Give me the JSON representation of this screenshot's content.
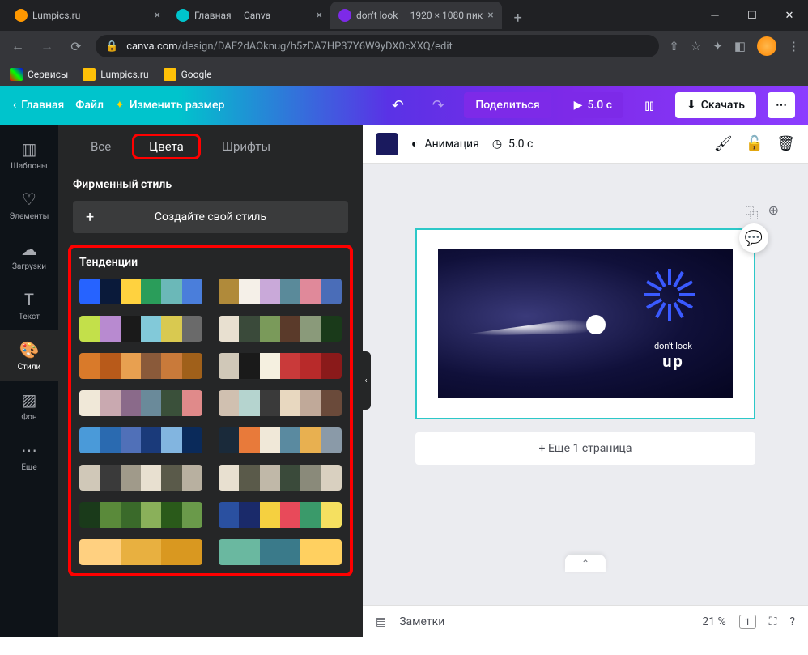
{
  "browser": {
    "tabs": [
      {
        "title": "Lumpics.ru",
        "favicon": "#ff9800"
      },
      {
        "title": "Главная — Canva",
        "favicon": "#00c4cc"
      },
      {
        "title": "don't look — 1920 × 1080 пик",
        "favicon": "#7d2ae8",
        "active": true
      }
    ],
    "url_domain": "canva.com",
    "url_path": "/design/DAE2dAOknug/h5zDA7HP37Y6W9yDX0cXXQ/edit",
    "bookmarks": [
      "Сервисы",
      "Lumpics.ru",
      "Google"
    ]
  },
  "header": {
    "home": "Главная",
    "file": "Файл",
    "resize": "Изменить размер",
    "share": "Поделиться",
    "duration": "5.0 с",
    "download": "Скачать"
  },
  "sidebar": [
    {
      "label": "Шаблоны",
      "icon": "templates"
    },
    {
      "label": "Элементы",
      "icon": "elements"
    },
    {
      "label": "Загрузки",
      "icon": "uploads"
    },
    {
      "label": "Текст",
      "icon": "text"
    },
    {
      "label": "Стили",
      "icon": "styles",
      "active": true
    },
    {
      "label": "Фон",
      "icon": "background"
    },
    {
      "label": "Еще",
      "icon": "more"
    }
  ],
  "panel": {
    "tabs": [
      "Все",
      "Цвета",
      "Шрифты"
    ],
    "active_tab": "Цвета",
    "brand_title": "Фирменный стиль",
    "create": "Создайте свой стиль",
    "trends_title": "Тенденции",
    "palettes": [
      [
        "#2663ff",
        "#0a1a3a",
        "#ffd23f",
        "#2a9d5a",
        "#6bb8b8",
        "#4a7edb"
      ],
      [
        "#b08a3a",
        "#f5f0e8",
        "#c9a9d9",
        "#5a8a9a",
        "#e0899a",
        "#4a6db8"
      ],
      [
        "#c3e04a",
        "#b88ad0",
        "#1a1a1a",
        "#82c9d9",
        "#d9c950",
        "#6a6a6a"
      ],
      [
        "#e8e0d0",
        "#3a4a3a",
        "#7a9a5a",
        "#5a3a2a",
        "#8a9a7a",
        "#1a3a1a"
      ],
      [
        "#d97a2a",
        "#b85a1a",
        "#e8a050",
        "#8a5a3a",
        "#c97a3a",
        "#a0601a"
      ],
      [
        "#d0c8b8",
        "#1a1a1a",
        "#f5f0e0",
        "#c93a3a",
        "#b82a2a",
        "#8a1a1a"
      ],
      [
        "#f0e8d8",
        "#c9a9b0",
        "#8a6a8a",
        "#6a8a9a",
        "#3a503a",
        "#e08a8a"
      ],
      [
        "#d0c0b0",
        "#b5d4cf",
        "#3a3a3a",
        "#e8d8c0",
        "#c0a999",
        "#6a4a3a"
      ],
      [
        "#4a9ad9",
        "#2a6ab0",
        "#5070b8",
        "#1a3a7a",
        "#82b5e0",
        "#0a2a5a"
      ],
      [
        "#1a2a3a",
        "#e87a3a",
        "#f0e8d8",
        "#5a8aa0",
        "#e8b050",
        "#8a9aa8"
      ],
      [
        "#d0c8b8",
        "#3a3a3a",
        "#a09a8a",
        "#e8e0d0",
        "#5a5a4a",
        "#b8b0a0"
      ],
      [
        "#e8e0d0",
        "#5a5a4a",
        "#c0b8a8",
        "#3a4a3a",
        "#8a8a7a",
        "#d9d0c0"
      ],
      [
        "#1a3a1a",
        "#5a8a3a",
        "#3a6a2a",
        "#8ab05a",
        "#2a5a1a",
        "#6a9a4a"
      ],
      [
        "#2a50a0",
        "#1a2a6a",
        "#f5d040",
        "#e84a5a",
        "#3a9a6a",
        "#f5e060"
      ],
      [
        "#ffd080",
        "#e8b040",
        "#d99820"
      ],
      [
        "#6ab8a0",
        "#3a7a8a",
        "#ffd060"
      ]
    ]
  },
  "toolbar": {
    "animation": "Анимация",
    "duration": "5.0 с"
  },
  "canvas": {
    "text1": "don't look",
    "text2": "up",
    "addpage": "+ Еще 1 страница"
  },
  "bottom": {
    "notes": "Заметки",
    "zoom": "21 %",
    "page": "1"
  }
}
